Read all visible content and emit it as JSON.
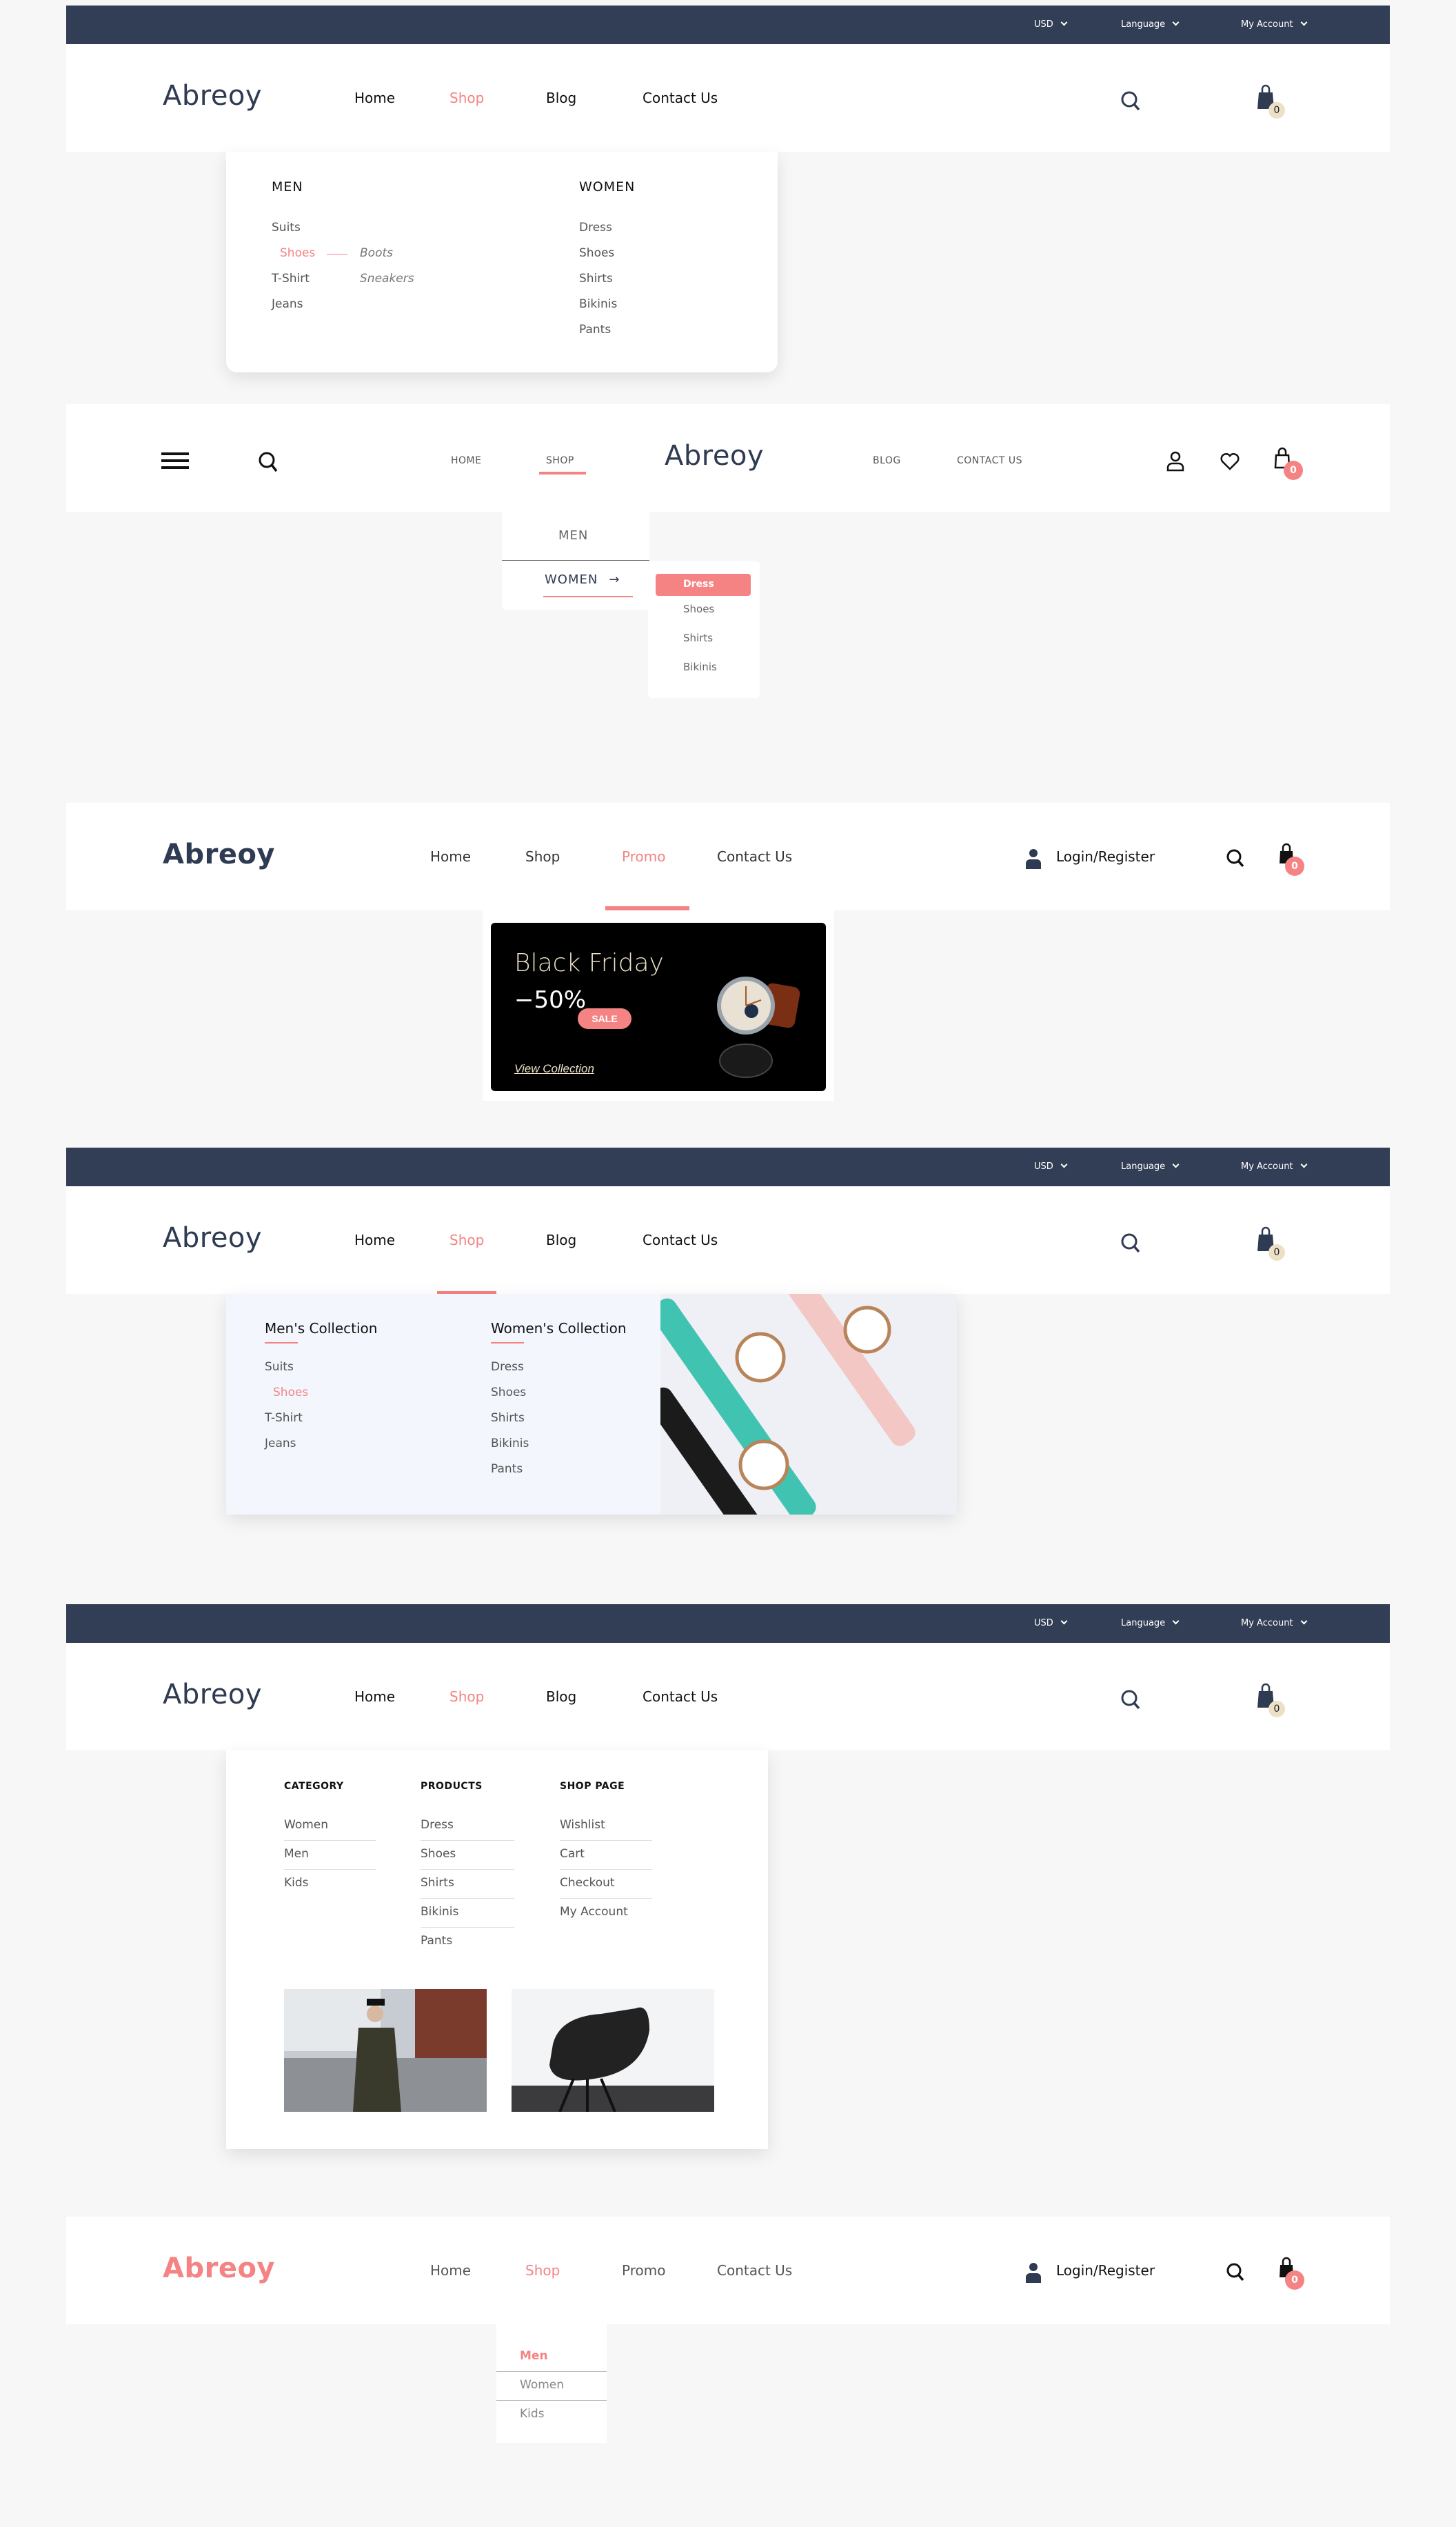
{
  "colors": {
    "accent": "#f58383",
    "navy": "#323e55",
    "logo": "#2f3b52",
    "page_bg": "#f7f7f7",
    "cart_badge_cream": "#ece0c6"
  },
  "topbar": {
    "currency": "USD",
    "language": "Language",
    "account": "My Account"
  },
  "brand": "Abreoy",
  "variant1": {
    "nav": [
      "Home",
      "Shop",
      "Blog",
      "Contact Us"
    ],
    "active": "Shop",
    "cart_count": "0",
    "dropdown": {
      "men_title": "MEN",
      "men_items": [
        "Suits",
        "Shoes",
        "T-Shirt",
        "Jeans"
      ],
      "men_active": "Shoes",
      "sub_items": [
        "Boots",
        "Sneakers"
      ],
      "women_title": "WOMEN",
      "women_items": [
        "Dress",
        "Shoes",
        "Shirts",
        "Bikinis",
        "Pants"
      ]
    }
  },
  "variant2": {
    "nav_left": [
      "HOME",
      "SHOP"
    ],
    "nav_right": [
      "BLOG",
      "CONTACT US"
    ],
    "active": "SHOP",
    "cart_count": "0",
    "dropdown": {
      "items": [
        "MEN",
        "WOMEN"
      ],
      "active": "WOMEN",
      "sub_items": [
        "Dress",
        "Shoes",
        "Shirts",
        "Bikinis"
      ],
      "sub_active": "Dress"
    }
  },
  "variant3": {
    "nav": [
      "Home",
      "Shop",
      "Promo",
      "Contact Us"
    ],
    "active": "Promo",
    "login": "Login/Register",
    "cart_count": "0",
    "promo": {
      "title": "Black Friday",
      "discount": "−50%",
      "badge": "SALE",
      "link": "View Collection"
    }
  },
  "variant4": {
    "nav": [
      "Home",
      "Shop",
      "Blog",
      "Contact Us"
    ],
    "active": "Shop",
    "cart_count": "0",
    "dropdown": {
      "men_title": "Men's Collection",
      "men_items": [
        "Suits",
        "Shoes",
        "T-Shirt",
        "Jeans"
      ],
      "men_active": "Shoes",
      "women_title": "Women's Collection",
      "women_items": [
        "Dress",
        "Shoes",
        "Shirts",
        "Bikinis",
        "Pants"
      ]
    }
  },
  "variant5": {
    "nav": [
      "Home",
      "Shop",
      "Blog",
      "Contact Us"
    ],
    "active": "Shop",
    "cart_count": "0",
    "dropdown": {
      "columns": [
        {
          "title": "CATEGORY",
          "items": [
            "Women",
            "Men",
            "Kids"
          ]
        },
        {
          "title": "PRODUCTS",
          "items": [
            "Dress",
            "Shoes",
            "Shirts",
            "Bikinis",
            "Pants"
          ]
        },
        {
          "title": "SHOP PAGE",
          "items": [
            "Wishlist",
            "Cart",
            "Checkout",
            "My Account"
          ]
        }
      ]
    }
  },
  "variant6": {
    "nav": [
      "Home",
      "Shop",
      "Promo",
      "Contact Us"
    ],
    "active": "Shop",
    "login": "Login/Register",
    "cart_count": "0",
    "dropdown": {
      "items": [
        "Men",
        "Women",
        "Kids"
      ],
      "active": "Men"
    }
  }
}
